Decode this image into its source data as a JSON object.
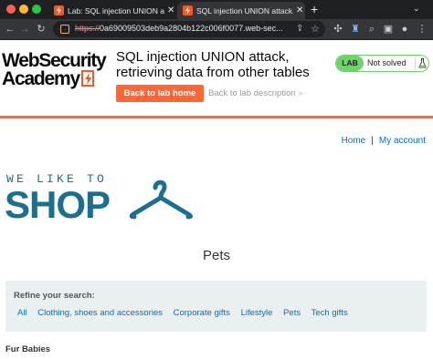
{
  "browser": {
    "tabs": [
      {
        "title": "Lab: SQL injection UNION atta",
        "active": false
      },
      {
        "title": "SQL injection UNION attack, r",
        "active": true
      }
    ],
    "new_tab": "+",
    "url_scheme": "https://",
    "url_rest": "0a69009503deb9a2804b122c006f0077.web-sec...",
    "colors": {
      "close": "#ff5f57",
      "minimize": "#febc2e",
      "maximize": "#28c840"
    }
  },
  "lab_header": {
    "logo_line1": "WebSecurity",
    "logo_line2": "Academy",
    "title": "SQL injection UNION attack, retrieving data from other tables",
    "back_button": "Back to lab home",
    "description_link": "Back to lab description",
    "description_chevron": "»",
    "status_badge": "LAB",
    "status_text": "Not solved",
    "accent": "#ff6633",
    "status_color": "#70d16d"
  },
  "shop": {
    "nav": {
      "home": "Home",
      "separator": "|",
      "account": "My account"
    },
    "tagline": "WE LIKE TO",
    "brand": "SHOP",
    "brand_color": "#1c6f8f",
    "category_title": "Pets",
    "filter": {
      "heading": "Refine your search:",
      "categories": [
        "All",
        "Clothing, shoes and accessories",
        "Corporate gifts",
        "Lifestyle",
        "Pets",
        "Tech gifts"
      ]
    },
    "first_product": "Fur Babies"
  }
}
